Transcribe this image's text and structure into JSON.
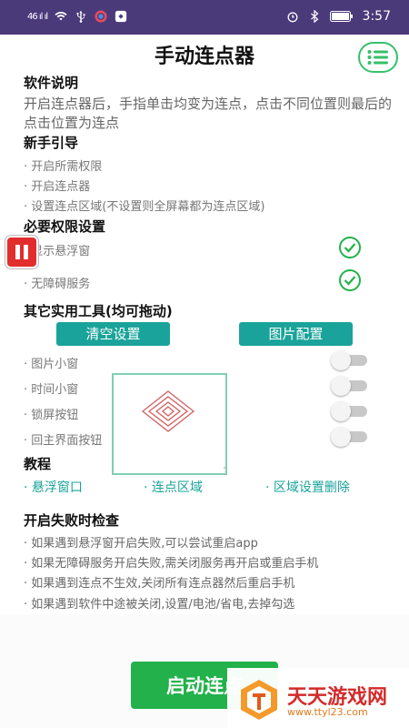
{
  "status_bar": {
    "signal": "46 ıl ıl",
    "time": "3:57",
    "icons": [
      "signal-icon",
      "wifi-icon",
      "usb-icon",
      "sync-icon",
      "app-icon",
      "alarm-icon",
      "bluetooth-icon",
      "battery-icon"
    ]
  },
  "header": {
    "title": "手动连点器",
    "menu_icon": "list-icon"
  },
  "software_desc": {
    "title": "软件说明",
    "text": "开启连点器后，手指单击均变为连点，点击不同位置则最后的点击位置为连点"
  },
  "guide": {
    "title": "新手引导",
    "items": [
      "· 开启所需权限",
      "· 开启连点器",
      "· 设置连点区域(不设置则全屏幕都为连点区域)"
    ]
  },
  "permissions": {
    "title": "必要权限设置",
    "items": [
      {
        "label": "· 显示悬浮窗",
        "granted": true
      },
      {
        "label": "· 无障碍服务",
        "granted": true
      }
    ]
  },
  "tools": {
    "title": "其它实用工具(均可拖动)",
    "buttons": [
      "清空设置",
      "图片配置"
    ],
    "items": [
      {
        "label": "· 图片小窗",
        "on": false
      },
      {
        "label": "· 时间小窗",
        "on": false
      },
      {
        "label": "· 锁屏按钮",
        "on": false
      },
      {
        "label": "· 回主界面按钮",
        "on": false
      }
    ]
  },
  "tutorial": {
    "title": "教程",
    "links": [
      "· 悬浮窗口",
      "· 连点区域",
      "· 区域设置删除"
    ]
  },
  "failure": {
    "title": "开启失败时检查",
    "items": [
      "· 如果遇到悬浮窗开启失败,可以尝试重启app",
      "· 如果无障碍服务开启失败,需关闭服务再开启或重启手机",
      "· 如果遇到连点不生效,关闭所有连点器然后重启手机",
      "· 如果遇到软件中途被关闭,设置/电池/省电,去掉勾选"
    ]
  },
  "start_button": "启动连点",
  "watermark": {
    "name": "天天游戏网",
    "url": "www.ttyl23.com"
  },
  "colors": {
    "status_bar": "#4b3a7a",
    "accent_green": "#22b14a",
    "teal": "#1aa39a",
    "pause_red": "#e22d2d"
  }
}
